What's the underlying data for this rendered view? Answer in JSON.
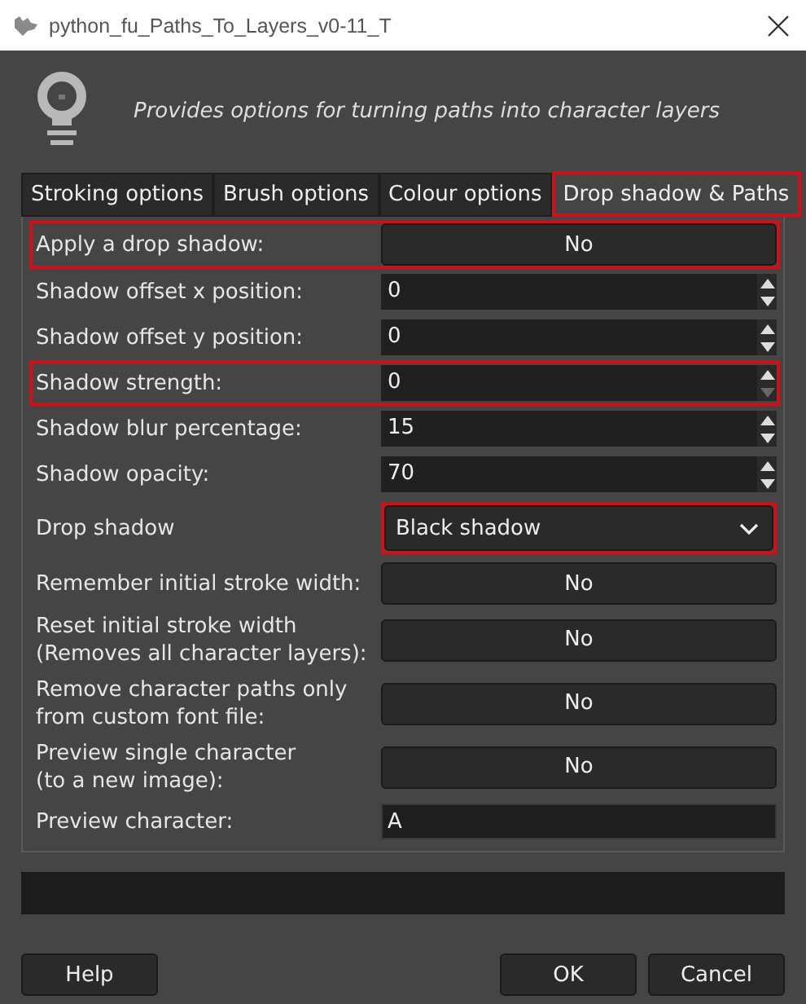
{
  "window": {
    "title": "python_fu_Paths_To_Layers_v0-11_T"
  },
  "description": "Provides options for turning paths into character layers",
  "tabs": [
    {
      "label": "Stroking options",
      "selected": false,
      "highlighted": false
    },
    {
      "label": "Brush options",
      "selected": false,
      "highlighted": false
    },
    {
      "label": "Colour options",
      "selected": false,
      "highlighted": false
    },
    {
      "label": "Drop shadow & Paths",
      "selected": true,
      "highlighted": true
    }
  ],
  "rows": [
    {
      "kind": "toggle",
      "label": "Apply a drop shadow:",
      "value": "No",
      "highlighted": true
    },
    {
      "kind": "spin",
      "label": "Shadow offset x position:",
      "value": "0",
      "down_disabled": false,
      "highlighted": false
    },
    {
      "kind": "spin",
      "label": "Shadow offset y position:",
      "value": "0",
      "down_disabled": false,
      "highlighted": false
    },
    {
      "kind": "spin",
      "label": "Shadow strength:",
      "value": "0",
      "down_disabled": true,
      "highlighted": true
    },
    {
      "kind": "spin",
      "label": "Shadow blur percentage:",
      "value": "15",
      "down_disabled": false,
      "highlighted": false
    },
    {
      "kind": "spin",
      "label": "Shadow opacity:",
      "value": "70",
      "down_disabled": false,
      "highlighted": false
    },
    {
      "kind": "dropdown",
      "label": "Drop shadow",
      "value": "Black shadow",
      "highlighted": true
    },
    {
      "kind": "toggle",
      "label": "Remember initial stroke width:",
      "value": "No",
      "highlighted": false
    },
    {
      "kind": "toggle",
      "label": "Reset initial stroke width\n(Removes all character layers):",
      "value": "No",
      "highlighted": false
    },
    {
      "kind": "toggle",
      "label": "Remove character paths only\nfrom custom font file:",
      "value": "No",
      "highlighted": false
    },
    {
      "kind": "toggle",
      "label": "Preview single character\n(to a new image):",
      "value": "No",
      "highlighted": false
    },
    {
      "kind": "text",
      "label": "Preview character:",
      "value": "A",
      "highlighted": false
    }
  ],
  "buttons": [
    {
      "label": "Help",
      "kind": "left"
    },
    {
      "label": "OK",
      "kind": "right"
    },
    {
      "label": "Cancel",
      "kind": "right"
    }
  ]
}
